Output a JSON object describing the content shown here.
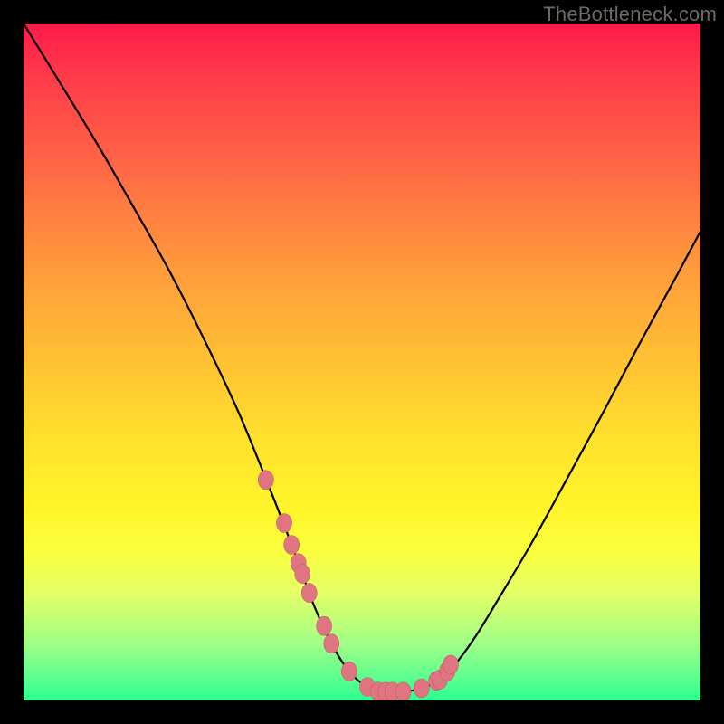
{
  "watermark": "TheBottleneck.com",
  "colors": {
    "background": "#000000",
    "gradient_top": "#ff1a4b",
    "gradient_bottom": "#2cff92",
    "curve_stroke": "#000000",
    "marker_fill": "#e07582",
    "marker_stroke": "#c85c69"
  },
  "chart_data": {
    "type": "line",
    "title": "",
    "xlabel": "",
    "ylabel": "",
    "xlim": [
      0,
      100
    ],
    "ylim": [
      0,
      100
    ],
    "grid": false,
    "legend": false,
    "note": "Axes have no visible tick labels; x/y are percent of plot width/height. y-axis inverted (0 at top).",
    "series": [
      {
        "name": "curve",
        "x": [
          0,
          10.3,
          16.0,
          21.4,
          26.7,
          32.1,
          37.4,
          40.1,
          42.8,
          45.5,
          48.1,
          50.8,
          53.5,
          56.1,
          58.8,
          61.5,
          64.2,
          66.8,
          69.5,
          74.9,
          80.2,
          85.6,
          90.9,
          96.3,
          100.0
        ],
        "y": [
          0,
          16.8,
          26.7,
          36.3,
          46.7,
          58.2,
          71.3,
          78.3,
          85.7,
          91.6,
          95.7,
          98.0,
          98.7,
          98.7,
          98.2,
          96.9,
          94.1,
          90.5,
          86.1,
          77.0,
          67.4,
          57.5,
          47.5,
          37.6,
          30.7
        ]
      }
    ],
    "markers": {
      "name": "highlight-dots",
      "x": [
        35.8,
        38.5,
        39.6,
        40.6,
        41.2,
        42.2,
        44.4,
        45.5,
        48.1,
        50.8,
        52.4,
        53.5,
        54.5,
        56.1,
        58.8,
        61.0,
        61.5,
        62.6,
        63.1
      ],
      "y": [
        67.4,
        73.8,
        77.0,
        79.7,
        81.3,
        84.1,
        89.0,
        91.6,
        95.7,
        98.0,
        98.7,
        98.7,
        98.7,
        98.7,
        98.2,
        97.1,
        96.9,
        95.7,
        94.7
      ]
    }
  }
}
